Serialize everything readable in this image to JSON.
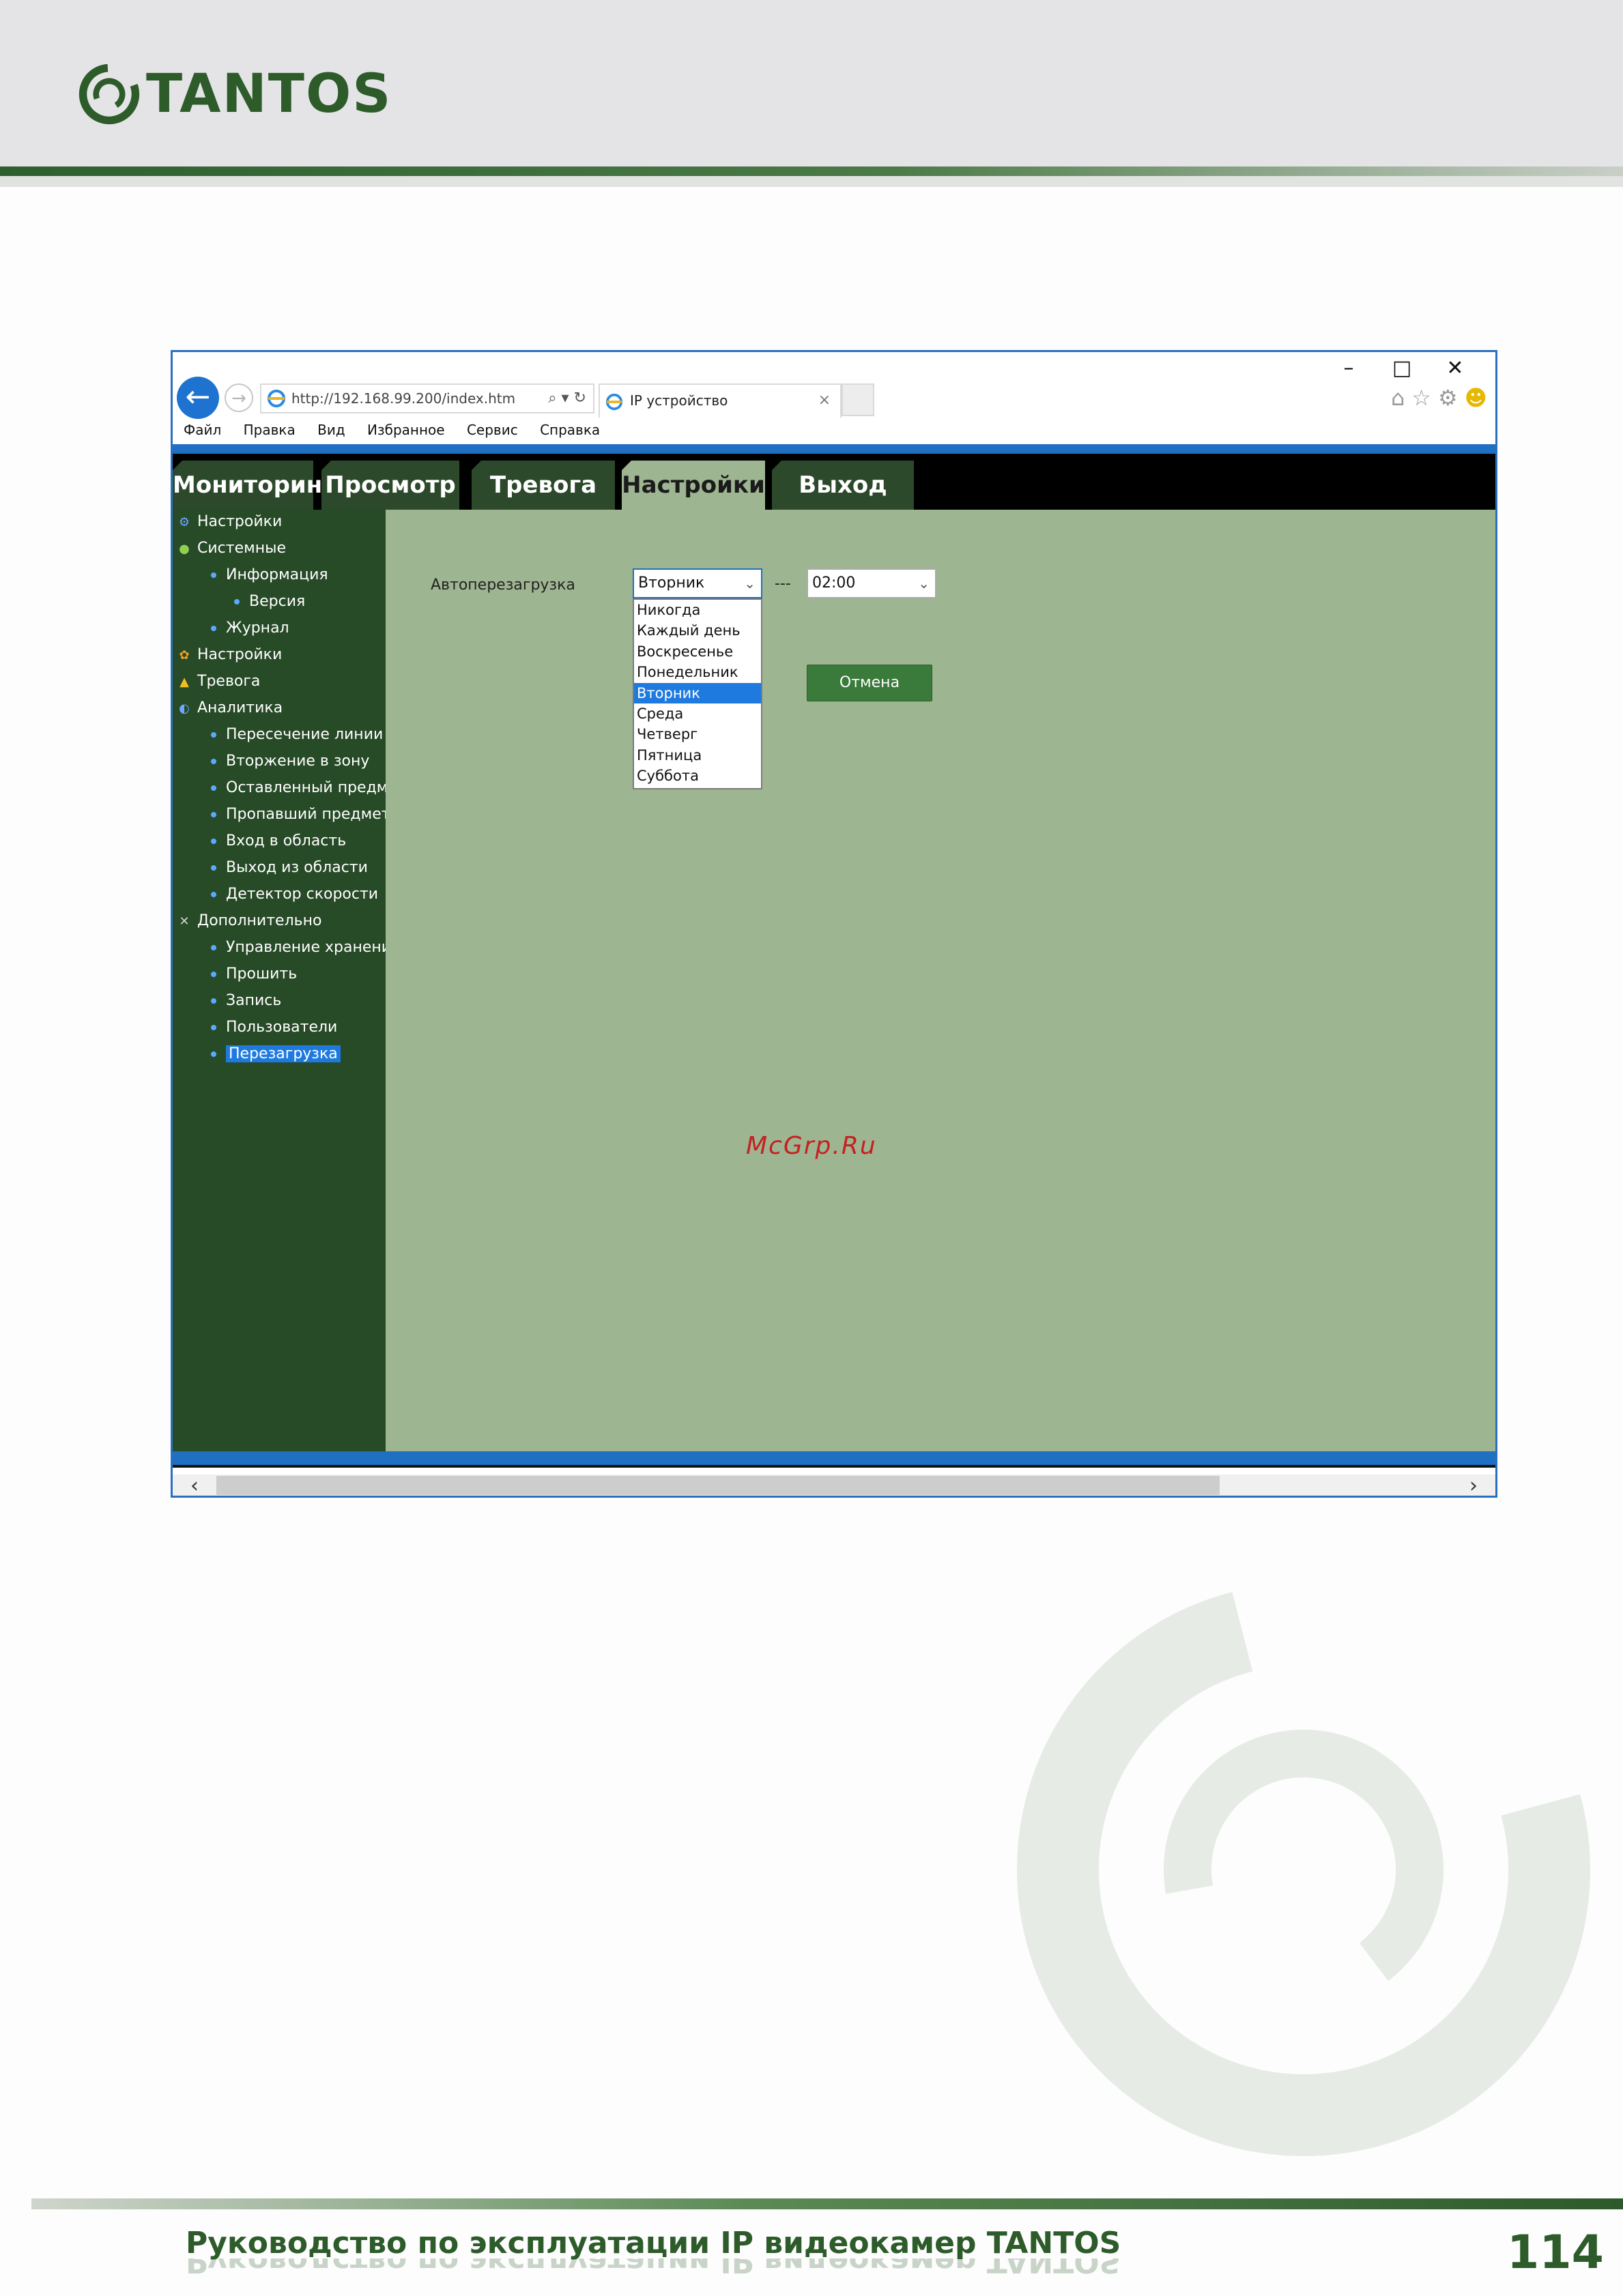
{
  "brand": {
    "name": "TANTOS"
  },
  "browser": {
    "address": "http://192.168.99.200/index.htm",
    "address_controls": "⌕ ▾ ↻",
    "tab_title": "IP устройство",
    "menu": [
      "Файл",
      "Правка",
      "Вид",
      "Избранное",
      "Сервис",
      "Справка"
    ]
  },
  "nav": {
    "tabs": [
      "Мониторинг",
      "Просмотр",
      "Тревога",
      "Настройки",
      "Выход"
    ],
    "active": "Настройки"
  },
  "sidebar": {
    "items": [
      {
        "label": "Настройки",
        "level": 0,
        "icon": "gear-small-icon"
      },
      {
        "label": "Системные",
        "level": 0,
        "icon": "info-icon"
      },
      {
        "label": "Информация",
        "level": 1
      },
      {
        "label": "Версия",
        "level": 2
      },
      {
        "label": "Журнал",
        "level": 1
      },
      {
        "label": "Настройки",
        "level": 0,
        "icon": "settings-icon"
      },
      {
        "label": "Тревога",
        "level": 0,
        "icon": "bell-icon"
      },
      {
        "label": "Аналитика",
        "level": 0,
        "icon": "analytics-icon"
      },
      {
        "label": "Пересечение линии",
        "level": 1
      },
      {
        "label": "Вторжение в зону",
        "level": 1
      },
      {
        "label": "Оставленный предме",
        "level": 1
      },
      {
        "label": "Пропавший предмет",
        "level": 1
      },
      {
        "label": "Вход в область",
        "level": 1
      },
      {
        "label": "Выход из области",
        "level": 1
      },
      {
        "label": "Детектор скорости",
        "level": 1
      },
      {
        "label": "Дополнительно",
        "level": 0,
        "icon": "tools-icon"
      },
      {
        "label": "Управление хранени",
        "level": 1
      },
      {
        "label": "Прошить",
        "level": 1
      },
      {
        "label": "Запись",
        "level": 1
      },
      {
        "label": "Пользователи",
        "level": 1
      },
      {
        "label": "Перезагрузка",
        "level": 1,
        "selected": true
      }
    ]
  },
  "form": {
    "auto_reboot_label": "Автоперезагрузка",
    "day_value": "Вторник",
    "separator": "---",
    "time_value": "02:00",
    "day_options": [
      "Никогда",
      "Каждый день",
      "Воскресенье",
      "Понедельник",
      "Вторник",
      "Среда",
      "Четверг",
      "Пятница",
      "Суббота"
    ],
    "highlighted_option": "Вторник",
    "cancel_label": "Отмена"
  },
  "watermark": "McGrp.Ru",
  "footer": {
    "title": "Руководство по эксплуатации IP видеокамер TANTOS",
    "page": "114"
  },
  "colors": {
    "brand_green": "#2d5c2a",
    "sidebar_bg": "#274a27",
    "content_bg": "#9db591",
    "accent_blue": "#1f6fc2",
    "selection": "#1f7ae0"
  }
}
